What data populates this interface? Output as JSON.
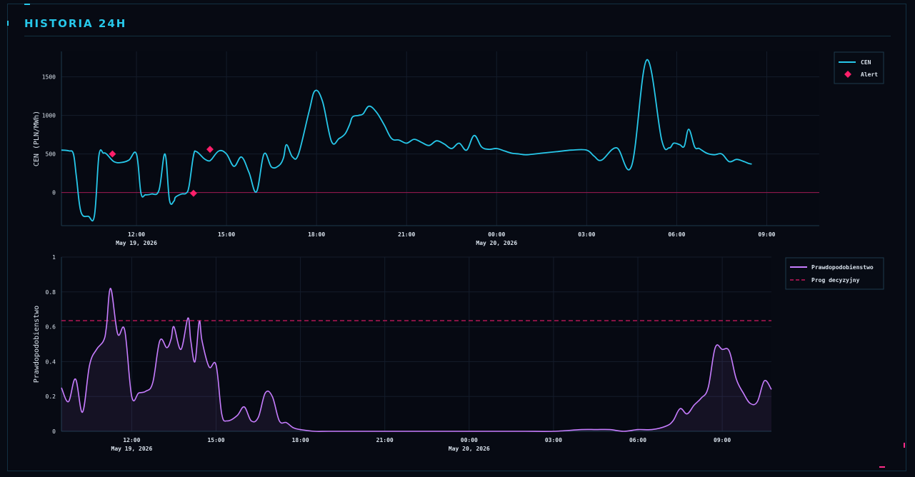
{
  "panel": {
    "title": "HISTORIA 24H"
  },
  "colors": {
    "background": "#070a13",
    "price_line": "#27c8ea",
    "alert_marker": "#ff1f6a",
    "prob_line": "#c77dff",
    "threshold": "#c2185b",
    "grid": "#141c2b",
    "axis": "#1e3b4d",
    "tick_text": "#d9e2ec"
  },
  "chart_data": [
    {
      "type": "line",
      "ylabel": "CEN (PLN/MWh)",
      "xlabel": "",
      "ylim": [
        -430,
        1830
      ],
      "yticks": [
        0,
        500,
        1000,
        1500
      ],
      "x_range_hours": [
        9.5,
        34.75
      ],
      "xticks": [
        {
          "hour": 12,
          "label": "12:00",
          "sublabel": "May 19, 2026"
        },
        {
          "hour": 15,
          "label": "15:00",
          "sublabel": ""
        },
        {
          "hour": 18,
          "label": "18:00",
          "sublabel": ""
        },
        {
          "hour": 21,
          "label": "21:00",
          "sublabel": ""
        },
        {
          "hour": 24,
          "label": "00:00",
          "sublabel": "May 20, 2026"
        },
        {
          "hour": 27,
          "label": "03:00",
          "sublabel": ""
        },
        {
          "hour": 30,
          "label": "06:00",
          "sublabel": ""
        },
        {
          "hour": 33,
          "label": "09:00",
          "sublabel": ""
        }
      ],
      "grid": true,
      "legend_position": "top-right",
      "reference_line": 0,
      "series": [
        {
          "name": "CEN",
          "x_hours": [
            9.5,
            9.75,
            9.9,
            10.0,
            10.15,
            10.4,
            10.6,
            10.75,
            10.9,
            11.0,
            11.25,
            11.5,
            11.75,
            12.0,
            12.15,
            12.3,
            12.5,
            12.75,
            12.95,
            13.1,
            13.25,
            13.3,
            13.5,
            13.65,
            13.75,
            13.9,
            14.0,
            14.25,
            14.4,
            14.5,
            14.75,
            15.0,
            15.25,
            15.5,
            15.75,
            16.0,
            16.25,
            16.5,
            16.75,
            16.9,
            17.0,
            17.2,
            17.4,
            17.75,
            17.95,
            18.2,
            18.5,
            18.75,
            18.95,
            19.1,
            19.2,
            19.4,
            19.55,
            19.75,
            20.0,
            20.25,
            20.5,
            20.75,
            21.0,
            21.25,
            21.5,
            21.75,
            22.0,
            22.25,
            22.5,
            22.75,
            23.0,
            23.25,
            23.5,
            23.75,
            24.0,
            24.25,
            24.5,
            24.75,
            25.0,
            25.5,
            26.0,
            26.5,
            27.0,
            27.25,
            27.5,
            28.0,
            28.5,
            29.0,
            29.5,
            29.75,
            29.9,
            30.1,
            30.25,
            30.4,
            30.6,
            30.75,
            31.0,
            31.25,
            31.5,
            31.75,
            32.0,
            32.25,
            32.5,
            32.75,
            33.0,
            33.25,
            33.5,
            33.75,
            34.0,
            34.25,
            34.5,
            34.75
          ],
          "y": [
            550,
            540,
            500,
            200,
            -250,
            -310,
            -300,
            480,
            510,
            500,
            400,
            390,
            420,
            500,
            -10,
            -30,
            -20,
            30,
            500,
            -100,
            -110,
            -60,
            -20,
            -10,
            80,
            480,
            530,
            440,
            410,
            430,
            540,
            500,
            340,
            460,
            260,
            10,
            500,
            330,
            350,
            450,
            620,
            460,
            500,
            1050,
            1320,
            1180,
            660,
            700,
            760,
            880,
            980,
            1000,
            1020,
            1120,
            1040,
            880,
            700,
            680,
            640,
            690,
            650,
            610,
            670,
            630,
            570,
            640,
            550,
            740,
            590,
            560,
            570,
            540,
            510,
            500,
            490,
            510,
            530,
            550,
            550,
            470,
            420,
            580,
            350,
            1720,
            680,
            580,
            640,
            620,
            600,
            820,
            590,
            570,
            510,
            490,
            500,
            400,
            430,
            400,
            370,
            420
          ],
          "y_note": ""
        }
      ],
      "alerts": {
        "name": "Alert",
        "x_hours": [
          11.2,
          13.9,
          14.45
        ],
        "y": [
          500,
          -10,
          560
        ]
      }
    },
    {
      "type": "area",
      "ylabel": "Prawdopodobienstwo",
      "xlabel": "",
      "ylim": [
        0,
        1
      ],
      "yticks": [
        0,
        0.2,
        0.4,
        0.6,
        0.8,
        1
      ],
      "x_range_hours": [
        9.5,
        34.75
      ],
      "xticks": [
        {
          "hour": 12,
          "label": "12:00",
          "sublabel": "May 19, 2026"
        },
        {
          "hour": 15,
          "label": "15:00",
          "sublabel": ""
        },
        {
          "hour": 18,
          "label": "18:00",
          "sublabel": ""
        },
        {
          "hour": 21,
          "label": "21:00",
          "sublabel": ""
        },
        {
          "hour": 24,
          "label": "00:00",
          "sublabel": "May 20, 2026"
        },
        {
          "hour": 27,
          "label": "03:00",
          "sublabel": ""
        },
        {
          "hour": 30,
          "label": "06:00",
          "sublabel": ""
        },
        {
          "hour": 33,
          "label": "09:00",
          "sublabel": ""
        }
      ],
      "grid": true,
      "legend_position": "top-right",
      "threshold": {
        "name": "Prog decyzyjny",
        "value": 0.635
      },
      "series": [
        {
          "name": "Prawdopodobienstwo",
          "x_hours": [
            9.5,
            9.75,
            10.0,
            10.25,
            10.5,
            10.75,
            11.0,
            11.1,
            11.25,
            11.5,
            11.75,
            12.0,
            12.25,
            12.5,
            12.75,
            13.0,
            13.25,
            13.4,
            13.5,
            13.75,
            14.0,
            14.1,
            14.25,
            14.4,
            14.5,
            14.75,
            15.0,
            15.2,
            15.4,
            15.75,
            16.0,
            16.25,
            16.5,
            16.75,
            17.0,
            17.25,
            17.5,
            17.75,
            18.0,
            18.5,
            19.0,
            20.0,
            21.0,
            22.0,
            23.0,
            24.0,
            25.0,
            26.0,
            27.0,
            28.0,
            28.5,
            29.0,
            29.5,
            30.0,
            30.5,
            31.0,
            31.25,
            31.5,
            31.75,
            32.0,
            32.25,
            32.5,
            32.75,
            33.0,
            33.25,
            33.5,
            33.75,
            34.0,
            34.25,
            34.5,
            34.75
          ],
          "y": [
            0.25,
            0.17,
            0.3,
            0.11,
            0.38,
            0.47,
            0.52,
            0.6,
            0.82,
            0.56,
            0.58,
            0.2,
            0.22,
            0.23,
            0.28,
            0.52,
            0.48,
            0.53,
            0.6,
            0.47,
            0.65,
            0.52,
            0.4,
            0.63,
            0.52,
            0.37,
            0.38,
            0.1,
            0.06,
            0.09,
            0.14,
            0.06,
            0.08,
            0.22,
            0.2,
            0.06,
            0.05,
            0.02,
            0.01,
            0.0,
            0.0,
            0.0,
            0.0,
            0.0,
            0.0,
            0.0,
            0.0,
            0.0,
            0.0,
            0.01,
            0.01,
            0.01,
            0.0,
            0.01,
            0.01,
            0.03,
            0.06,
            0.13,
            0.1,
            0.15,
            0.19,
            0.25,
            0.48,
            0.47,
            0.46,
            0.3,
            0.22,
            0.16,
            0.17,
            0.29,
            0.24
          ],
          "y_note": ""
        }
      ]
    }
  ]
}
